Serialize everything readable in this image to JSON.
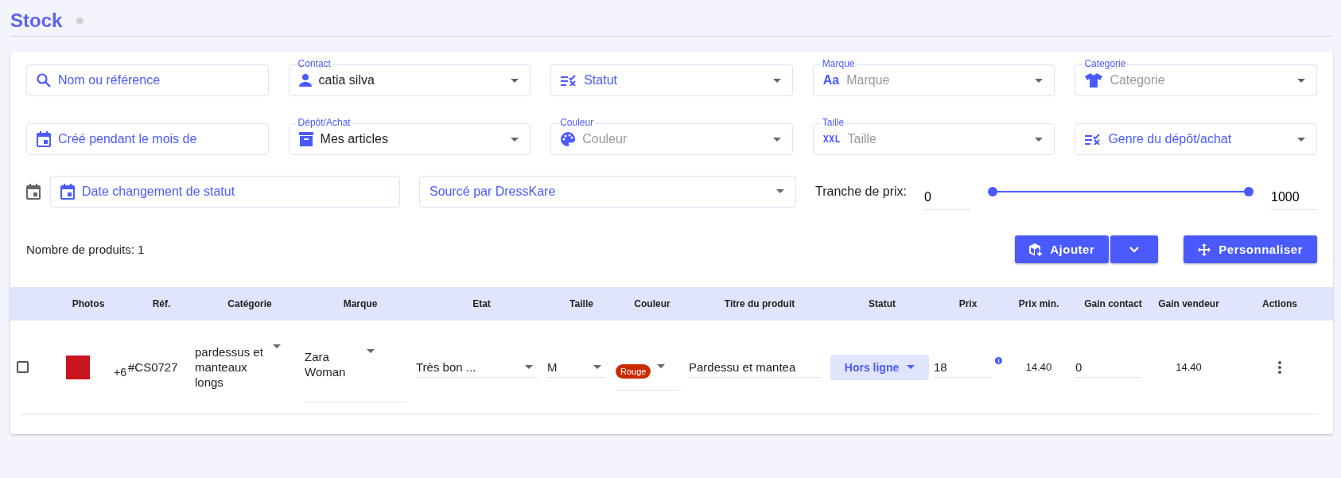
{
  "page": {
    "title": "Stock"
  },
  "filters": [
    {
      "kind": "search",
      "placeholder": "Nom ou référence"
    },
    {
      "kind": "select",
      "label": "Contact",
      "value": "catia silva"
    },
    {
      "kind": "select",
      "placeholder": "Statut"
    },
    {
      "kind": "select",
      "label": "Marque",
      "placeholder": "Marque",
      "icon_text": "Aa"
    },
    {
      "kind": "select",
      "label": "Categorie",
      "placeholder": "Categorie"
    },
    {
      "kind": "date",
      "placeholder": "Créé pendant le mois de"
    },
    {
      "kind": "select",
      "label": "Dépôt/Achat",
      "value": "Mes articles"
    },
    {
      "kind": "select",
      "label": "Couleur",
      "placeholder": "Couleur"
    },
    {
      "kind": "select",
      "label": "Taille",
      "placeholder": "Taille",
      "icon_text": "XXL"
    },
    {
      "kind": "select",
      "placeholder": "Genre du dépôt/achat"
    }
  ],
  "status_date": {
    "placeholder": "Date changement de statut"
  },
  "sourced": {
    "placeholder": "Sourcé par DressKare"
  },
  "price_range": {
    "label": "Tranche de prix:",
    "min": "0",
    "max": "1000",
    "thumbs": [
      {
        "level": 0
      },
      {
        "level": 1
      }
    ]
  },
  "product_count": "Nombre de produits: 1",
  "buttons": {
    "add": "Ajouter",
    "customize": "Personnaliser"
  },
  "table": {
    "columns": [
      "Photos",
      "Réf.",
      "Catégorie",
      "Marque",
      "Etat",
      "Taille",
      "Couleur",
      "Titre du produit",
      "Statut",
      "Prix",
      "Prix min.",
      "Gain contact",
      "Gain vendeur",
      "Actions"
    ],
    "rows": [
      {
        "checked": false,
        "photo_count": "+6",
        "ref": "#CS0727",
        "category": "pardessus et manteaux longs",
        "brand": "Zara Woman",
        "condition": "Très bon ...",
        "size": "M",
        "color_tag": {
          "label": "Rouge",
          "color": "#cc2a00"
        },
        "title": "Pardessu et mantea",
        "status": "Hors ligne",
        "price": "18",
        "min_price": "14.40",
        "contact_gain": "0",
        "seller_gain": "14.40"
      }
    ]
  }
}
